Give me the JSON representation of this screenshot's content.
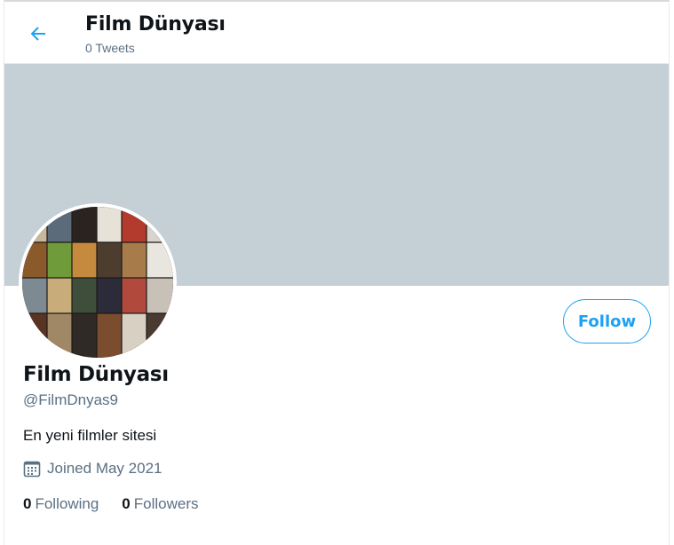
{
  "header": {
    "title": "Film Dünyası",
    "tweet_count": "0 Tweets"
  },
  "colors": {
    "banner": "#c4cfd6",
    "accent": "#1da1f2",
    "secondary_text": "#5b7083"
  },
  "profile": {
    "name": "Film Dünyası",
    "handle": "@FilmDnyas9",
    "bio": "En yeni filmler sitesi",
    "joined": "Joined May 2021",
    "following_count": "0",
    "following_label": "Following",
    "followers_count": "0",
    "followers_label": "Followers",
    "avatar_icon": "movie-poster-collage"
  },
  "actions": {
    "follow_label": "Follow",
    "back_icon": "arrow-left-icon"
  }
}
